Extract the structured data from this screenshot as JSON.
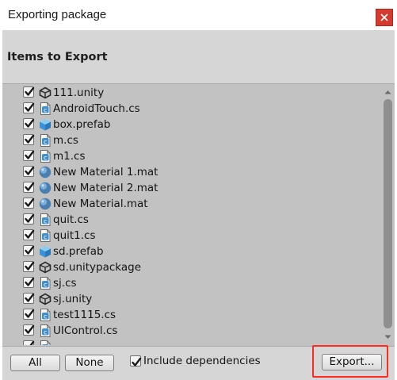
{
  "window": {
    "title": "Exporting package"
  },
  "header": {
    "title": "Items to Export"
  },
  "items": [
    {
      "label": "111.unity",
      "icon": "unity-scene-icon",
      "checked": true
    },
    {
      "label": "AndroidTouch.cs",
      "icon": "csharp-script-icon",
      "checked": true
    },
    {
      "label": "box.prefab",
      "icon": "prefab-cube-icon",
      "checked": true
    },
    {
      "label": "m.cs",
      "icon": "csharp-script-icon",
      "checked": true
    },
    {
      "label": "m1.cs",
      "icon": "csharp-script-icon",
      "checked": true
    },
    {
      "label": "New Material 1.mat",
      "icon": "material-sphere-icon",
      "checked": true
    },
    {
      "label": "New Material 2.mat",
      "icon": "material-sphere-icon",
      "checked": true
    },
    {
      "label": "New Material.mat",
      "icon": "material-sphere-icon",
      "checked": true
    },
    {
      "label": "quit.cs",
      "icon": "csharp-script-icon",
      "checked": true
    },
    {
      "label": "quit1.cs",
      "icon": "csharp-script-icon",
      "checked": true
    },
    {
      "label": "sd.prefab",
      "icon": "prefab-cube-icon",
      "checked": true
    },
    {
      "label": "sd.unitypackage",
      "icon": "unity-package-icon",
      "checked": true
    },
    {
      "label": "sj.cs",
      "icon": "csharp-script-icon",
      "checked": true
    },
    {
      "label": "sj.unity",
      "icon": "unity-scene-icon",
      "checked": true
    },
    {
      "label": "test1115.cs",
      "icon": "csharp-script-icon",
      "checked": true
    },
    {
      "label": "UIControl.cs",
      "icon": "csharp-script-icon",
      "checked": true
    },
    {
      "label": "",
      "icon": "csharp-script-icon",
      "checked": true
    }
  ],
  "footer": {
    "all_label": "All",
    "none_label": "None",
    "include_dependencies_label": "Include dependencies",
    "include_dependencies_checked": true,
    "export_label": "Export..."
  },
  "colors": {
    "background": "#c2c2c2",
    "panel": "#d6d6d6",
    "highlight": "#ff2a20",
    "close": "#d33b2f"
  }
}
